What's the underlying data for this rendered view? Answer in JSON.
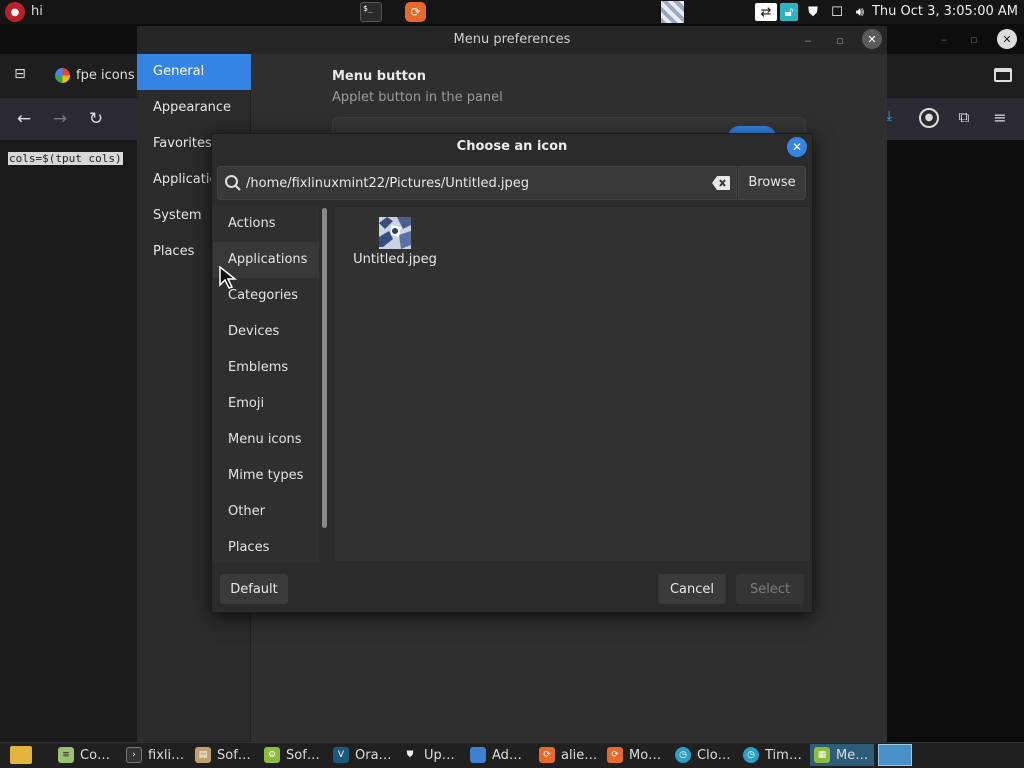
{
  "top_panel": {
    "app_label": "hi",
    "clock": "Thu Oct  3,  3:05:00 AM"
  },
  "firefox": {
    "tab_label": "fpe icons"
  },
  "terminal": {
    "selected_text": "cols=$(tput cols)"
  },
  "menu_preferences": {
    "title": "Menu preferences",
    "sidebar": [
      "General",
      "Appearance",
      "Favorites",
      "Applications",
      "System",
      "Places"
    ],
    "active_index": 0,
    "section_heading": "Menu button",
    "section_subtitle": "Applet button in the panel",
    "toggle_on": true
  },
  "dialog": {
    "title": "Choose an icon",
    "search": {
      "value": "/home/fixlinuxmint22/Pictures/Untitled.jpeg",
      "browse_label": "Browse"
    },
    "categories": [
      "Actions",
      "Applications",
      "Categories",
      "Devices",
      "Emblems",
      "Emoji",
      "Menu icons",
      "Mime types",
      "Other",
      "Places"
    ],
    "hover_index": 1,
    "icons": [
      {
        "name": "Untitled.jpeg"
      }
    ],
    "buttons": {
      "default": "Default",
      "cancel": "Cancel",
      "select": "Select"
    }
  },
  "taskbar": {
    "items": [
      {
        "label": "Co…",
        "icon": "text-editor-icon"
      },
      {
        "label": "fixli…",
        "icon": "terminal-icon"
      },
      {
        "label": "Sof…",
        "icon": "software-manager-icon"
      },
      {
        "label": "Sof…",
        "icon": "software-sources-icon"
      },
      {
        "label": "Ora…",
        "icon": "oracle-icon"
      },
      {
        "label": "Up…",
        "icon": "update-manager-icon"
      },
      {
        "label": "Ad…",
        "icon": "window-icon"
      },
      {
        "label": "alie…",
        "icon": "firefox-icon"
      },
      {
        "label": "Mo…",
        "icon": "firefox-icon"
      },
      {
        "label": "Clo…",
        "icon": "clock-icon"
      },
      {
        "label": "Tim…",
        "icon": "clock-icon"
      },
      {
        "label": "Me…",
        "icon": "menu-icon"
      }
    ],
    "active_index": 11
  },
  "colors": {
    "accent": "#3584e4",
    "dialog_bg": "#2b2b2b",
    "panel_bg": "#151515"
  }
}
